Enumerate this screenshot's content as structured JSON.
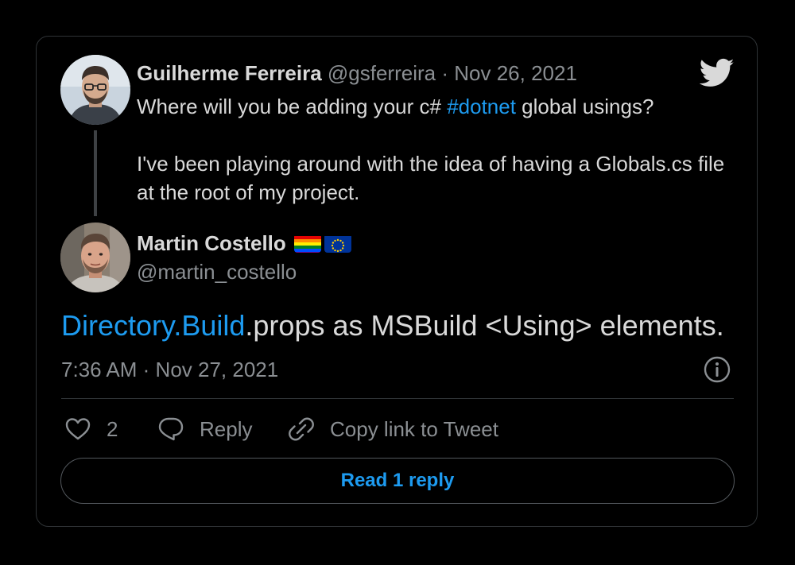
{
  "quoted_tweet": {
    "author_name": "Guilherme Ferreira",
    "author_handle": "@gsferreira",
    "separator": "·",
    "date": "Nov 26, 2021",
    "text_before_hashtag": "Where will you be adding your c# ",
    "hashtag": "#dotnet",
    "text_after_hashtag": " global usings?",
    "paragraph_2": "I've been playing around with the idea of having a Globals.cs file at the root of my project."
  },
  "tweet": {
    "author_name": "Martin Costello",
    "author_flags": [
      "rainbow-flag-icon",
      "eu-flag-icon"
    ],
    "author_handle": "@martin_costello",
    "text_link": "Directory.Build",
    "text_rest": ".props as MSBuild <Using> elements.",
    "time": "7:36 AM",
    "separator": "·",
    "date": "Nov 27, 2021"
  },
  "actions": {
    "like_count": "2",
    "reply_label": "Reply",
    "copy_link_label": "Copy link to Tweet"
  },
  "read_reply_label": "Read 1 reply",
  "colors": {
    "background": "#000000",
    "link": "#1d9bf0",
    "text": "#d9d9d9",
    "muted": "#8b8f93",
    "border": "#2f3336"
  },
  "icons": {
    "brand": "twitter-bird-icon",
    "info": "info-icon",
    "like": "heart-icon",
    "reply": "speech-bubble-icon",
    "copy_link": "link-icon"
  }
}
